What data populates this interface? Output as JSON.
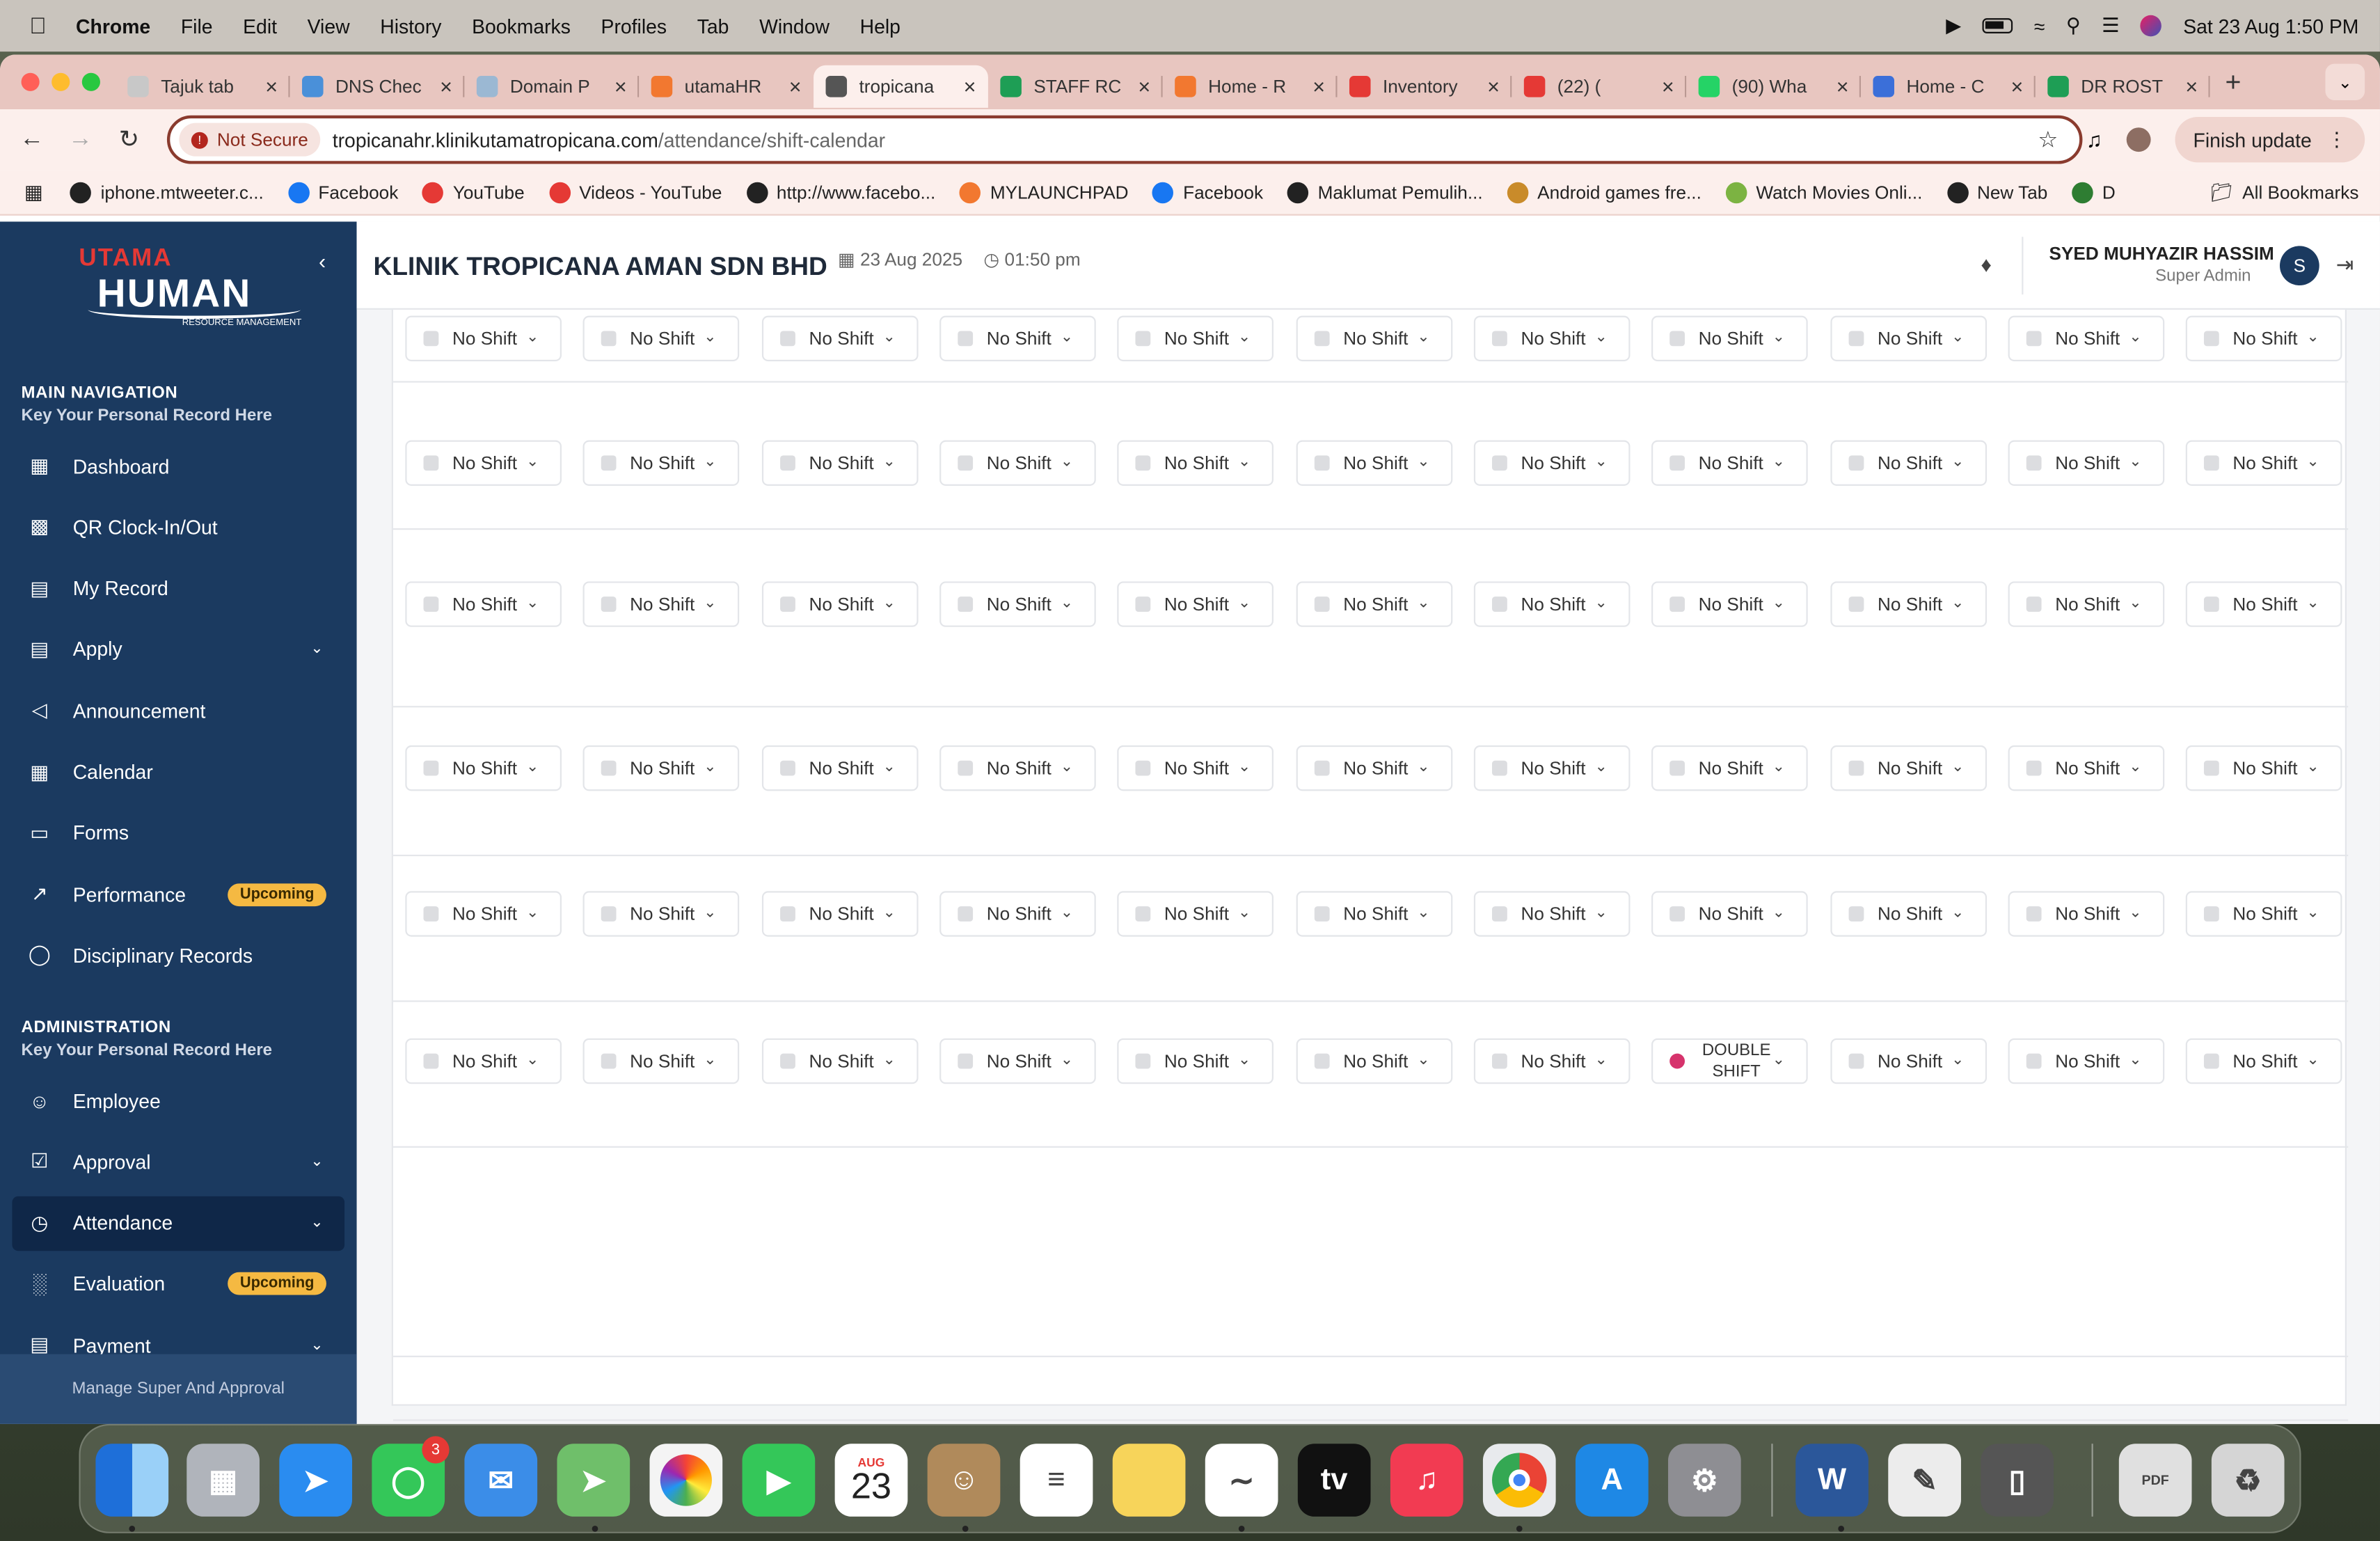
{
  "menubar": {
    "app": "Chrome",
    "items": [
      "File",
      "Edit",
      "View",
      "History",
      "Bookmarks",
      "Profiles",
      "Tab",
      "Window",
      "Help"
    ],
    "datetime": "Sat 23 Aug  1:50 PM"
  },
  "tabs": [
    {
      "title": "Tajuk tab",
      "color": "#c8c8c8"
    },
    {
      "title": "DNS Chec",
      "color": "#4a90d9"
    },
    {
      "title": "Domain P",
      "color": "#9bb8d3"
    },
    {
      "title": "utamaHR",
      "color": "#f27830"
    },
    {
      "title": "tropicana",
      "color": "#555555"
    },
    {
      "title": "STAFF RC",
      "color": "#1e9e55"
    },
    {
      "title": "Home - R",
      "color": "#f27830"
    },
    {
      "title": "Inventory",
      "color": "#e53935"
    },
    {
      "title": "(22) (",
      "color": "#e53935"
    },
    {
      "title": "(90) Wha",
      "color": "#25d366"
    },
    {
      "title": "Home - C",
      "color": "#3b6fd9"
    },
    {
      "title": "DR ROST",
      "color": "#1e9e55"
    }
  ],
  "toolbar": {
    "security": "Not Secure",
    "url_host": "tropicanahr.klinikutamatropicana.com",
    "url_path": "/attendance/shift-calendar",
    "finish_update": "Finish update"
  },
  "bookmarks": [
    {
      "label": "iphone.mtweeter.c...",
      "color": "#222"
    },
    {
      "label": "Facebook",
      "color": "#1877f2"
    },
    {
      "label": "YouTube",
      "color": "#e53935"
    },
    {
      "label": "Videos - YouTube",
      "color": "#e53935"
    },
    {
      "label": "http://www.facebo...",
      "color": "#222"
    },
    {
      "label": "MYLAUNCHPAD",
      "color": "#f27830"
    },
    {
      "label": "Facebook",
      "color": "#1877f2"
    },
    {
      "label": "Maklumat Pemulih...",
      "color": "#222"
    },
    {
      "label": "Android games fre...",
      "color": "#c98b2a"
    },
    {
      "label": "Watch Movies Onli...",
      "color": "#7cb342"
    },
    {
      "label": "New Tab",
      "color": "#222"
    },
    {
      "label": "D",
      "color": "#2e7d32"
    }
  ],
  "all_bookmarks": "All Bookmarks",
  "sidebar": {
    "main_title": "MAIN NAVIGATION",
    "main_sub": "Key Your Personal Record Here",
    "main_items": [
      {
        "label": "Dashboard",
        "icon": "dashboard-icon"
      },
      {
        "label": "QR Clock-In/Out",
        "icon": "qr-icon"
      },
      {
        "label": "My Record",
        "icon": "record-icon"
      },
      {
        "label": "Apply",
        "icon": "apply-icon",
        "chevron": true
      },
      {
        "label": "Announcement",
        "icon": "megaphone-icon"
      },
      {
        "label": "Calendar",
        "icon": "calendar-icon"
      },
      {
        "label": "Forms",
        "icon": "forms-icon"
      },
      {
        "label": "Performance",
        "icon": "trend-icon",
        "badge": "Upcoming"
      },
      {
        "label": "Disciplinary Records",
        "icon": "shield-icon"
      }
    ],
    "admin_title": "ADMINISTRATION",
    "admin_sub": "Key Your Personal Record Here",
    "admin_items": [
      {
        "label": "Employee",
        "icon": "users-icon"
      },
      {
        "label": "Approval",
        "icon": "approval-icon",
        "chevron": true
      },
      {
        "label": "Attendance",
        "icon": "clock-icon",
        "chevron": true,
        "active": true
      },
      {
        "label": "Evaluation",
        "icon": "chart-icon",
        "badge": "Upcoming"
      },
      {
        "label": "Payment",
        "icon": "payment-icon",
        "chevron": true
      }
    ],
    "footer": "Manage Super And Approval"
  },
  "header": {
    "company": "KLINIK TROPICANA AMAN SDN BHD",
    "date": "23 Aug 2025",
    "time": "01:50 pm",
    "user_name": "SYED MUHYAZIR HASSIM",
    "user_role": "Super Admin",
    "avatar_letter": "S"
  },
  "shift_grid": {
    "default_label": "No Shift",
    "rows": [
      [
        "No Shift",
        "No Shift",
        "No Shift",
        "No Shift",
        "No Shift",
        "No Shift",
        "No Shift",
        "No Shift",
        "No Shift",
        "No Shift",
        "No Shift"
      ],
      [
        "No Shift",
        "No Shift",
        "No Shift",
        "No Shift",
        "No Shift",
        "No Shift",
        "No Shift",
        "No Shift",
        "No Shift",
        "No Shift",
        "No Shift"
      ],
      [
        "No Shift",
        "No Shift",
        "No Shift",
        "No Shift",
        "No Shift",
        "No Shift",
        "No Shift",
        "No Shift",
        "No Shift",
        "No Shift",
        "No Shift"
      ],
      [
        "No Shift",
        "No Shift",
        "No Shift",
        "No Shift",
        "No Shift",
        "No Shift",
        "No Shift",
        "No Shift",
        "No Shift",
        "No Shift",
        "No Shift"
      ],
      [
        "No Shift",
        "No Shift",
        "No Shift",
        "No Shift",
        "No Shift",
        "No Shift",
        "No Shift",
        "No Shift",
        "No Shift",
        "No Shift",
        "No Shift"
      ],
      [
        "No Shift",
        "No Shift",
        "No Shift",
        "No Shift",
        "No Shift",
        "No Shift",
        "No Shift",
        "DOUBLE SHIFT",
        "No Shift",
        "No Shift",
        "No Shift"
      ]
    ],
    "double_shift_color": "#d6336c"
  },
  "dock": {
    "messages_badge": "3",
    "calendar_month": "AUG",
    "calendar_day": "23",
    "apps": [
      "Finder",
      "Launchpad",
      "Safari",
      "Messages",
      "Mail",
      "Maps",
      "Photos",
      "FaceTime",
      "Calendar",
      "Contacts",
      "Reminders",
      "Notes",
      "Freeform",
      "TV",
      "Music",
      "Chrome",
      "App Store",
      "System Settings",
      "Word",
      "TextEdit",
      "iPhone Mirroring",
      "PDF",
      "Trash"
    ]
  }
}
